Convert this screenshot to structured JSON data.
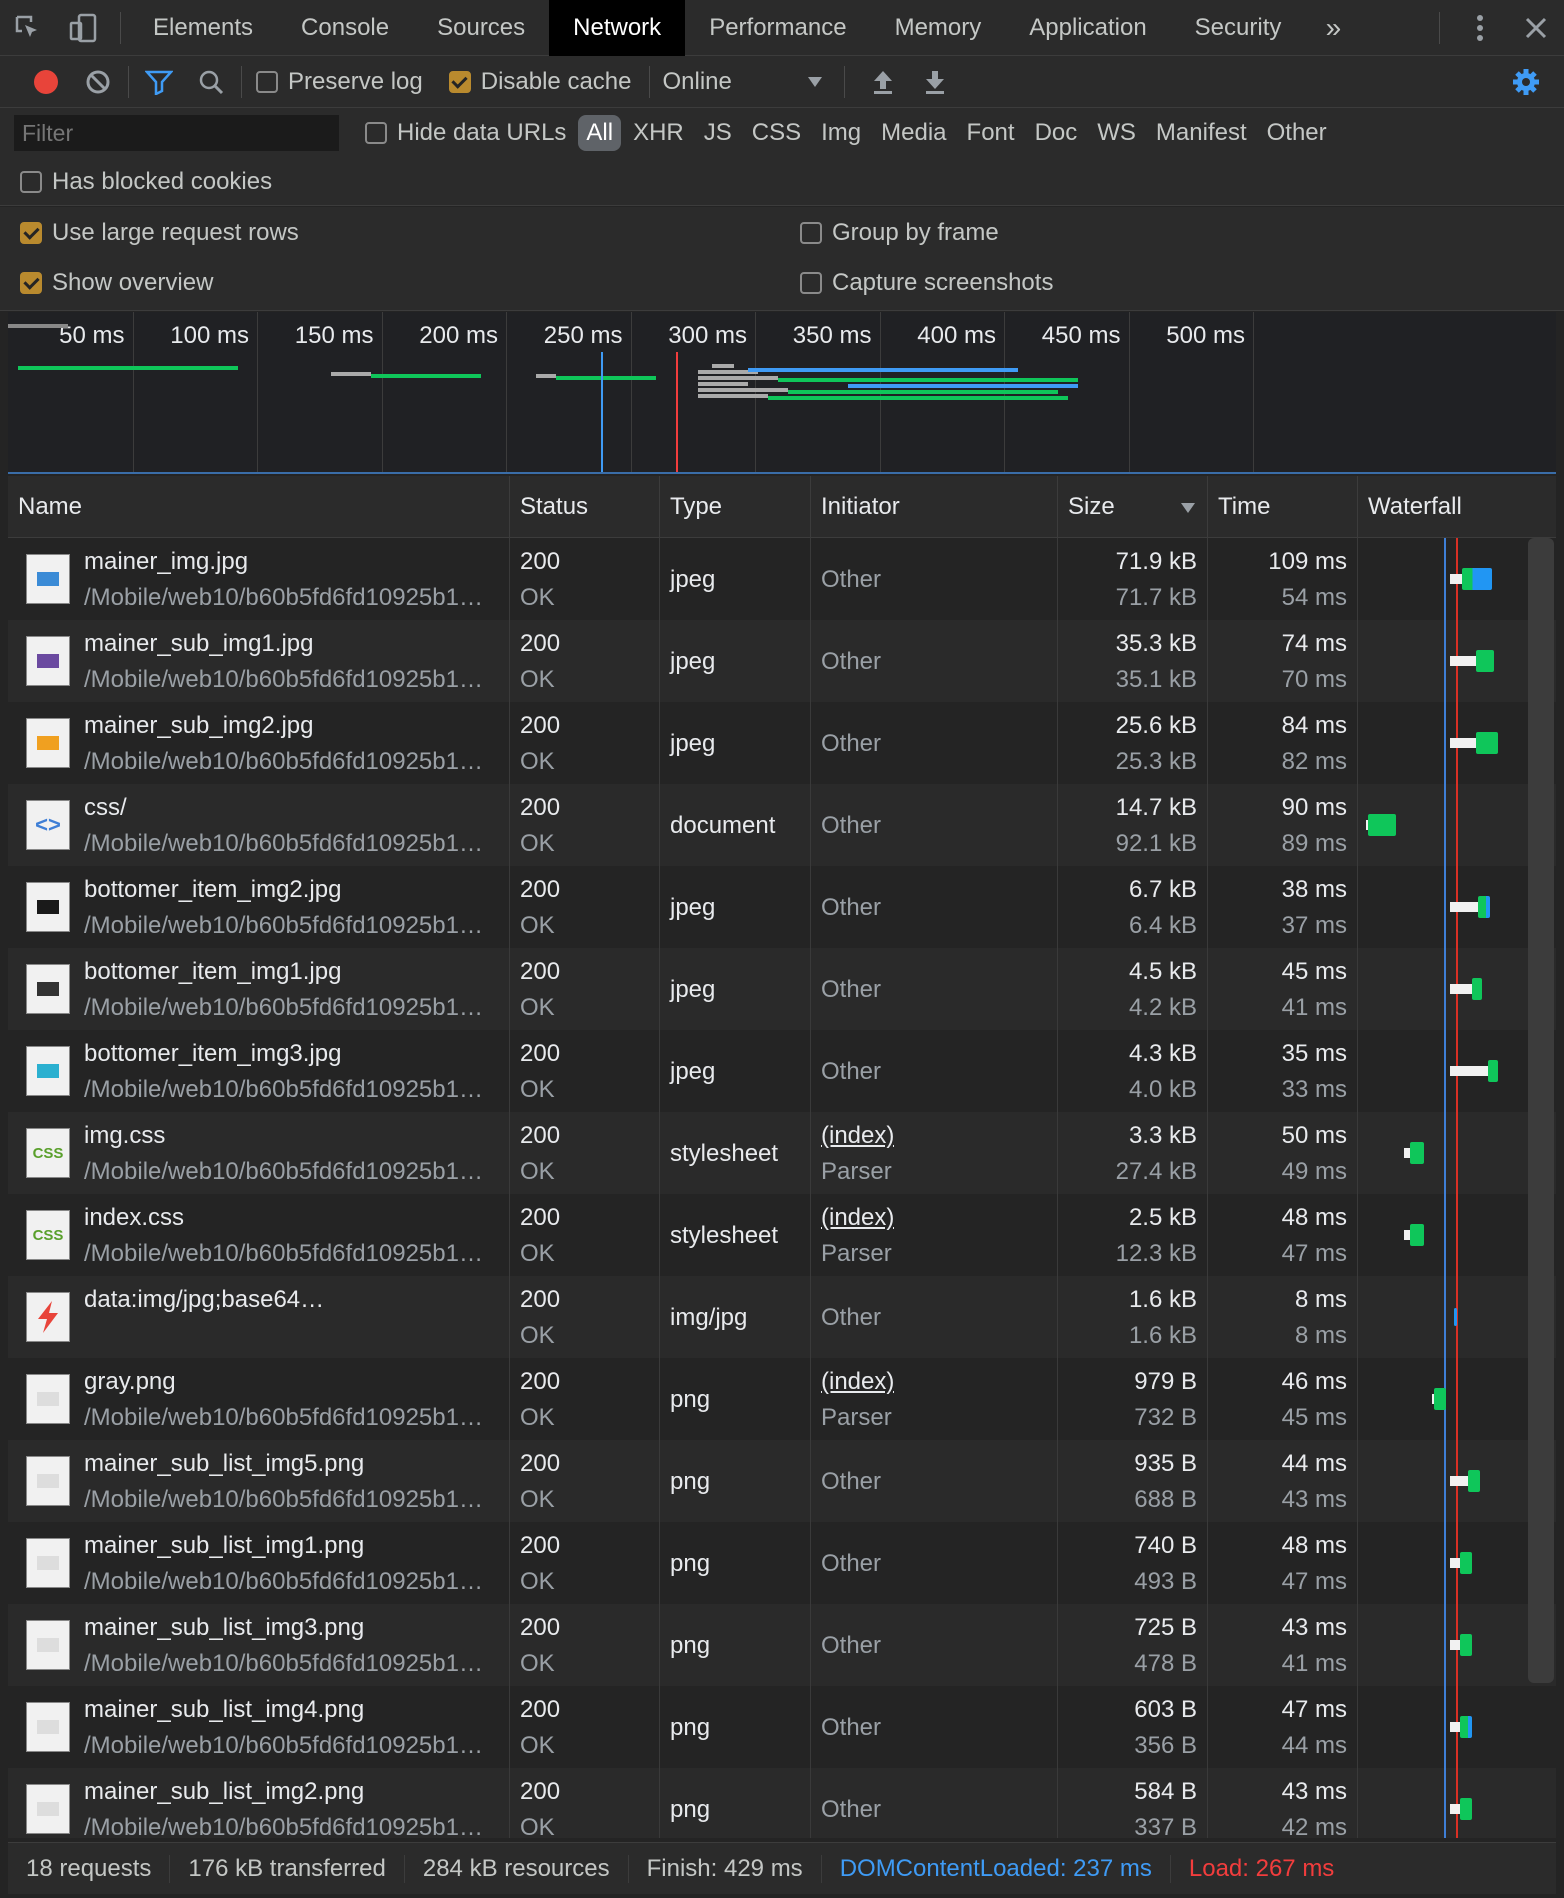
{
  "tabs": [
    "Elements",
    "Console",
    "Sources",
    "Network",
    "Performance",
    "Memory",
    "Application",
    "Security"
  ],
  "active_tab": "Network",
  "toolbar": {
    "preserve_log": {
      "label": "Preserve log",
      "checked": false
    },
    "disable_cache": {
      "label": "Disable cache",
      "checked": true
    },
    "throttle": "Online"
  },
  "filter": {
    "placeholder": "Filter",
    "hide_data_urls": "Hide data URLs",
    "types": [
      "All",
      "XHR",
      "JS",
      "CSS",
      "Img",
      "Media",
      "Font",
      "Doc",
      "WS",
      "Manifest",
      "Other"
    ],
    "has_blocked_cookies": "Has blocked cookies"
  },
  "settings": {
    "large_rows": {
      "label": "Use large request rows",
      "checked": true
    },
    "show_overview": {
      "label": "Show overview",
      "checked": true
    },
    "group_by_frame": {
      "label": "Group by frame",
      "checked": false
    },
    "capture_screenshots": {
      "label": "Capture screenshots",
      "checked": false
    }
  },
  "overview_ticks": [
    "50 ms",
    "100 ms",
    "150 ms",
    "200 ms",
    "250 ms",
    "300 ms",
    "350 ms",
    "400 ms",
    "450 ms",
    "500 ms"
  ],
  "columns": {
    "name": "Name",
    "status": "Status",
    "type": "Type",
    "initiator": "Initiator",
    "size": "Size",
    "time": "Time",
    "waterfall": "Waterfall"
  },
  "requests": [
    {
      "name": "mainer_img.jpg",
      "path": "/Mobile/web10/b60b5fd6fd10925b1…",
      "status": "200",
      "status_text": "OK",
      "type": "jpeg",
      "initiator": "Other",
      "initiator_sub": "",
      "size": "71.9 kB",
      "resource": "71.7 kB",
      "time": "109 ms",
      "latency": "54 ms",
      "icon": "image-thumb-icon"
    },
    {
      "name": "mainer_sub_img1.jpg",
      "path": "/Mobile/web10/b60b5fd6fd10925b1…",
      "status": "200",
      "status_text": "OK",
      "type": "jpeg",
      "initiator": "Other",
      "initiator_sub": "",
      "size": "35.3 kB",
      "resource": "35.1 kB",
      "time": "74 ms",
      "latency": "70 ms",
      "icon": "image-thumb-icon"
    },
    {
      "name": "mainer_sub_img2.jpg",
      "path": "/Mobile/web10/b60b5fd6fd10925b1…",
      "status": "200",
      "status_text": "OK",
      "type": "jpeg",
      "initiator": "Other",
      "initiator_sub": "",
      "size": "25.6 kB",
      "resource": "25.3 kB",
      "time": "84 ms",
      "latency": "82 ms",
      "icon": "image-thumb-icon"
    },
    {
      "name": "css/",
      "path": "/Mobile/web10/b60b5fd6fd10925b1…",
      "status": "200",
      "status_text": "OK",
      "type": "document",
      "initiator": "Other",
      "initiator_sub": "",
      "size": "14.7 kB",
      "resource": "92.1 kB",
      "time": "90 ms",
      "latency": "89 ms",
      "icon": "document-icon"
    },
    {
      "name": "bottomer_item_img2.jpg",
      "path": "/Mobile/web10/b60b5fd6fd10925b1…",
      "status": "200",
      "status_text": "OK",
      "type": "jpeg",
      "initiator": "Other",
      "initiator_sub": "",
      "size": "6.7 kB",
      "resource": "6.4 kB",
      "time": "38 ms",
      "latency": "37 ms",
      "icon": "image-thumb-icon"
    },
    {
      "name": "bottomer_item_img1.jpg",
      "path": "/Mobile/web10/b60b5fd6fd10925b1…",
      "status": "200",
      "status_text": "OK",
      "type": "jpeg",
      "initiator": "Other",
      "initiator_sub": "",
      "size": "4.5 kB",
      "resource": "4.2 kB",
      "time": "45 ms",
      "latency": "41 ms",
      "icon": "image-thumb-icon"
    },
    {
      "name": "bottomer_item_img3.jpg",
      "path": "/Mobile/web10/b60b5fd6fd10925b1…",
      "status": "200",
      "status_text": "OK",
      "type": "jpeg",
      "initiator": "Other",
      "initiator_sub": "",
      "size": "4.3 kB",
      "resource": "4.0 kB",
      "time": "35 ms",
      "latency": "33 ms",
      "icon": "image-thumb-icon"
    },
    {
      "name": "img.css",
      "path": "/Mobile/web10/b60b5fd6fd10925b1…",
      "status": "200",
      "status_text": "OK",
      "type": "stylesheet",
      "initiator": "(index)",
      "initiator_sub": "Parser",
      "size": "3.3 kB",
      "resource": "27.4 kB",
      "time": "50 ms",
      "latency": "49 ms",
      "icon": "css-file-icon"
    },
    {
      "name": "index.css",
      "path": "/Mobile/web10/b60b5fd6fd10925b1…",
      "status": "200",
      "status_text": "OK",
      "type": "stylesheet",
      "initiator": "(index)",
      "initiator_sub": "Parser",
      "size": "2.5 kB",
      "resource": "12.3 kB",
      "time": "48 ms",
      "latency": "47 ms",
      "icon": "css-file-icon"
    },
    {
      "name": "data:img/jpg;base64…",
      "path": "",
      "status": "200",
      "status_text": "OK",
      "type": "img/jpg",
      "initiator": "Other",
      "initiator_sub": "",
      "size": "1.6 kB",
      "resource": "1.6 kB",
      "time": "8 ms",
      "latency": "8 ms",
      "icon": "lightning-icon"
    },
    {
      "name": "gray.png",
      "path": "/Mobile/web10/b60b5fd6fd10925b1…",
      "status": "200",
      "status_text": "OK",
      "type": "png",
      "initiator": "(index)",
      "initiator_sub": "Parser",
      "size": "979 B",
      "resource": "732 B",
      "time": "46 ms",
      "latency": "45 ms",
      "icon": "image-thumb-icon"
    },
    {
      "name": "mainer_sub_list_img5.png",
      "path": "/Mobile/web10/b60b5fd6fd10925b1…",
      "status": "200",
      "status_text": "OK",
      "type": "png",
      "initiator": "Other",
      "initiator_sub": "",
      "size": "935 B",
      "resource": "688 B",
      "time": "44 ms",
      "latency": "43 ms",
      "icon": "image-thumb-icon"
    },
    {
      "name": "mainer_sub_list_img1.png",
      "path": "/Mobile/web10/b60b5fd6fd10925b1…",
      "status": "200",
      "status_text": "OK",
      "type": "png",
      "initiator": "Other",
      "initiator_sub": "",
      "size": "740 B",
      "resource": "493 B",
      "time": "48 ms",
      "latency": "47 ms",
      "icon": "image-thumb-icon"
    },
    {
      "name": "mainer_sub_list_img3.png",
      "path": "/Mobile/web10/b60b5fd6fd10925b1…",
      "status": "200",
      "status_text": "OK",
      "type": "png",
      "initiator": "Other",
      "initiator_sub": "",
      "size": "725 B",
      "resource": "478 B",
      "time": "43 ms",
      "latency": "41 ms",
      "icon": "image-thumb-icon"
    },
    {
      "name": "mainer_sub_list_img4.png",
      "path": "/Mobile/web10/b60b5fd6fd10925b1…",
      "status": "200",
      "status_text": "OK",
      "type": "png",
      "initiator": "Other",
      "initiator_sub": "",
      "size": "603 B",
      "resource": "356 B",
      "time": "47 ms",
      "latency": "44 ms",
      "icon": "image-thumb-icon"
    },
    {
      "name": "mainer_sub_list_img2.png",
      "path": "/Mobile/web10/b60b5fd6fd10925b1…",
      "status": "200",
      "status_text": "OK",
      "type": "png",
      "initiator": "Other",
      "initiator_sub": "",
      "size": "584 B",
      "resource": "337 B",
      "time": "43 ms",
      "latency": "42 ms",
      "icon": "image-thumb-icon"
    }
  ],
  "summary": {
    "requests": "18 requests",
    "transferred": "176 kB transferred",
    "resources": "284 kB resources",
    "finish": "Finish: 429 ms",
    "dom_content_loaded": "DOMContentLoaded: 237 ms",
    "load": "Load: 267 ms"
  },
  "colors": {
    "record": "#e8443a",
    "dcl": "#3f9bf5",
    "load": "#f23d3d",
    "accent": "#b98a2e",
    "waterfall_green": "#0fc65a",
    "waterfall_blue": "#2196f3"
  }
}
